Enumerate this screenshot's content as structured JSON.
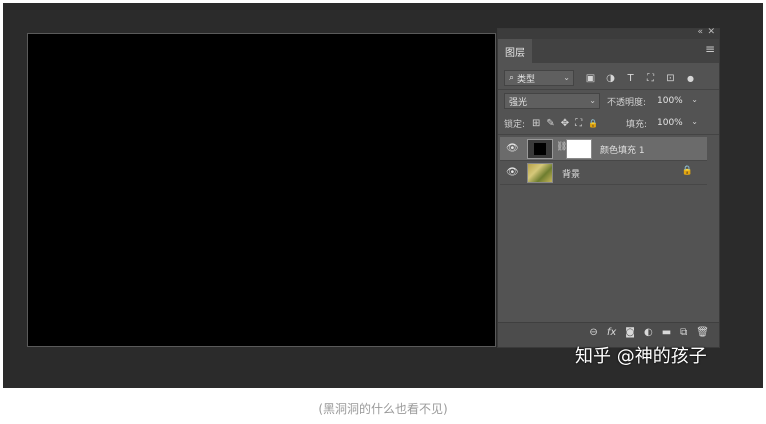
{
  "panel": {
    "collapse_icon": "«",
    "close_icon": "✕",
    "tab_label": "图层",
    "menu_icon": "≡",
    "filter": {
      "icon": "⌕",
      "value": "类型",
      "chevron": "⌄"
    },
    "filter_icons": [
      "▣",
      "◑",
      "T",
      "⛶",
      "⊡"
    ],
    "filter_toggle": "●",
    "blend": {
      "value": "强光",
      "chevron": "⌄"
    },
    "opacity": {
      "label": "不透明度:",
      "value": "100%",
      "chevron": "⌄"
    },
    "lock": {
      "label": "锁定:",
      "icons": [
        "⊞",
        "✎",
        "✥",
        "⛶",
        "🔒"
      ]
    },
    "fill": {
      "label": "填充:",
      "value": "100%",
      "chevron": "⌄"
    },
    "layers": [
      {
        "name": "颜色填充 1",
        "eye": "👁",
        "chain": "⛓",
        "selected": true
      },
      {
        "name": "背景",
        "eye": "👁",
        "lock": "🔒",
        "selected": false
      }
    ],
    "bottom_icons": [
      "⊖",
      "fx",
      "◙",
      "◐",
      "▬",
      "⧉",
      "🗑"
    ]
  },
  "watermark": "知乎 @神的孩子",
  "caption": "(黑洞洞的什么也看不见)"
}
